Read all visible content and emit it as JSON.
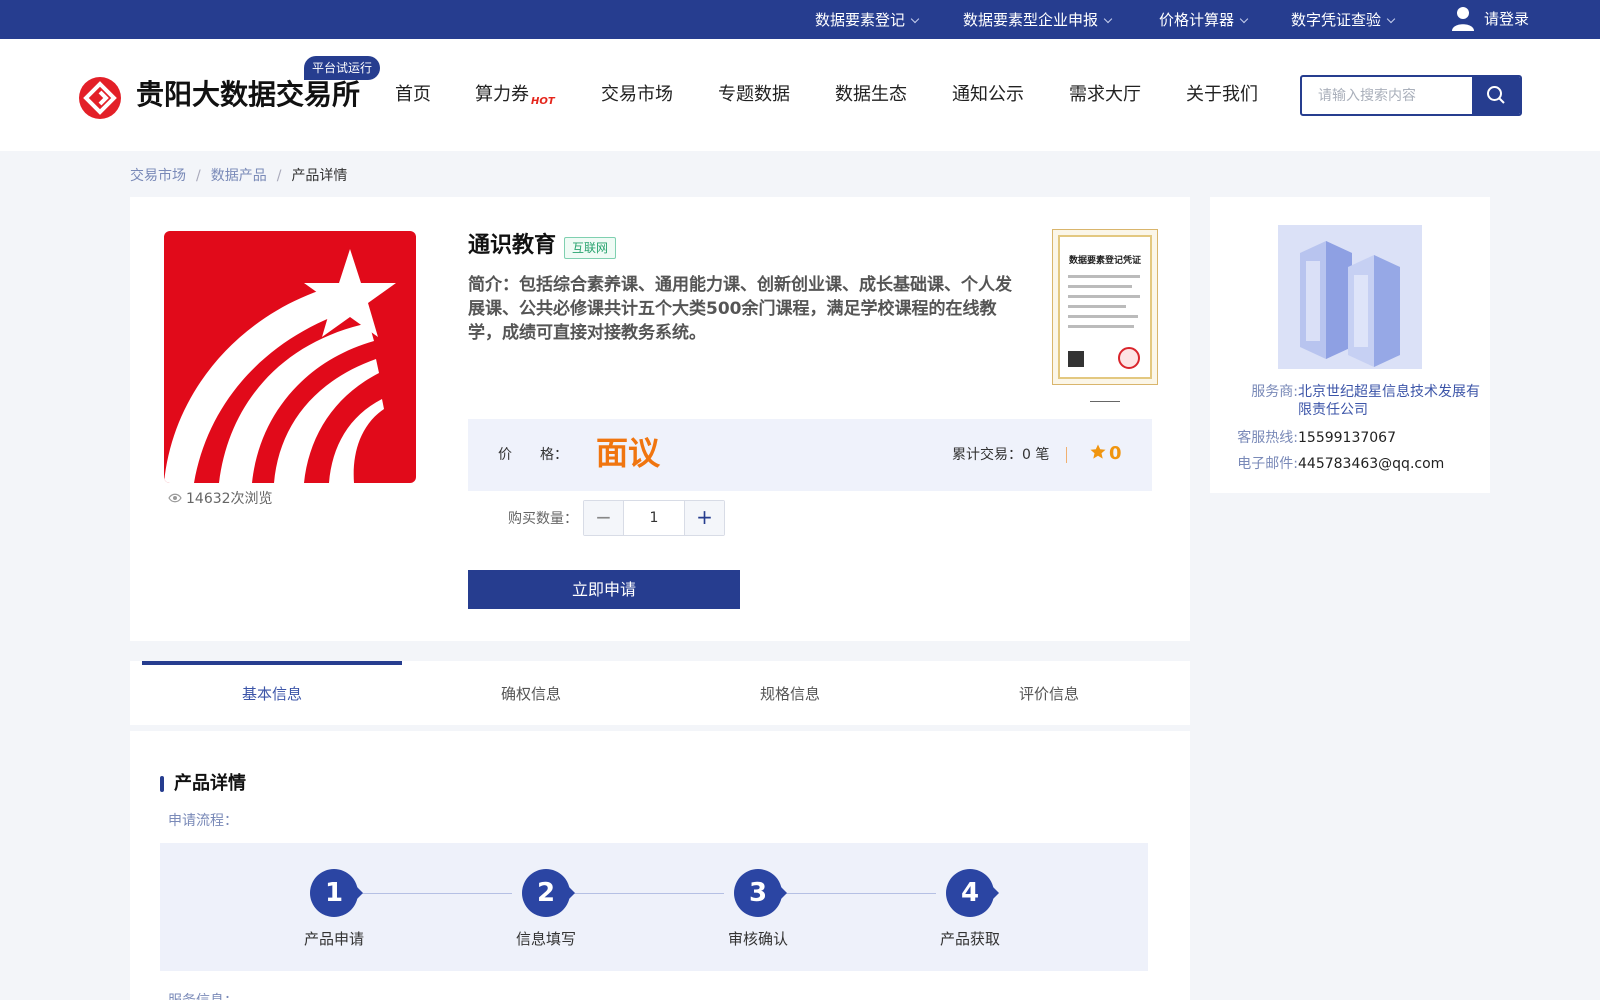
{
  "topbar": {
    "links": [
      "数据要素登记",
      "数据要素型企业申报",
      "价格计算器",
      "数字凭证查验"
    ],
    "login": "请登录"
  },
  "header": {
    "logo_text": "贵阳大数据交易所",
    "badge": "平台试运行",
    "nav": [
      "首页",
      "算力券",
      "交易市场",
      "专题数据",
      "数据生态",
      "通知公示",
      "需求大厅",
      "关于我们"
    ],
    "hot_label": "HOT",
    "search_placeholder": "请输入搜索内容"
  },
  "breadcrumb": {
    "items": [
      "交易市场",
      "数据产品",
      "产品详情"
    ],
    "separator": "/"
  },
  "product": {
    "title": "通识教育",
    "tag": "互联网",
    "description": "简介：包括综合素养课、通用能力课、创新创业课、成长基础课、个人发展课、公共必修课共计五个大类500余门课程，满足学校课程的在线教学，成绩可直接对接教务系统。",
    "views": "14632次浏览",
    "cert_title": "数据要素登记凭证",
    "price_label": "价　　格：",
    "price": "面议",
    "trades": "累计交易：0 笔",
    "rating": "0",
    "qty_label": "购买数量：",
    "qty_value": "1",
    "qty_minus": "−",
    "qty_plus": "+",
    "apply": "立即申请"
  },
  "provider": {
    "rows": [
      {
        "key": "服务商:",
        "value": "北京世纪超星信息技术发展有限责任公司"
      },
      {
        "key": "客服热线:",
        "value": "15599137067"
      },
      {
        "key": "电子邮件:",
        "value": "445783463@qq.com"
      }
    ]
  },
  "tabs": [
    "基本信息",
    "确权信息",
    "规格信息",
    "评价信息"
  ],
  "detail": {
    "title": "产品详情",
    "flow_label": "申请流程：",
    "steps": [
      {
        "num": "1",
        "label": "产品申请"
      },
      {
        "num": "2",
        "label": "信息填写"
      },
      {
        "num": "3",
        "label": "审核确认"
      },
      {
        "num": "4",
        "label": "产品获取"
      }
    ],
    "service_label": "服务信息："
  },
  "colors": {
    "brand": "#263d8f",
    "price": "#f0750f",
    "logo_red": "#e10a1a"
  }
}
